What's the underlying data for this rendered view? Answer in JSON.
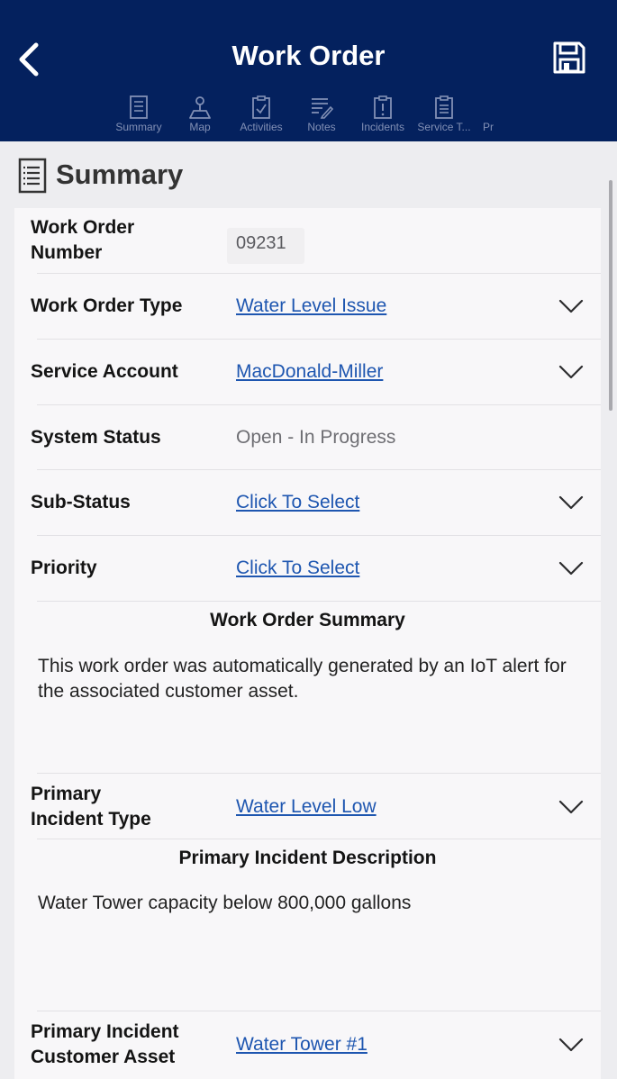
{
  "header": {
    "title": "Work Order",
    "back_icon": "chevron-left-icon",
    "save_icon": "floppy-disk-icon",
    "colors": {
      "background": "#04215e",
      "tab_text": "#8290b5"
    }
  },
  "tabs": [
    {
      "label": "Summary",
      "icon": "list-document-icon"
    },
    {
      "label": "Map",
      "icon": "map-pin-icon"
    },
    {
      "label": "Activities",
      "icon": "clipboard-check-icon"
    },
    {
      "label": "Notes",
      "icon": "notes-pencil-icon"
    },
    {
      "label": "Incidents",
      "icon": "clipboard-alert-icon"
    },
    {
      "label": "Service T...",
      "icon": "clipboard-list-icon"
    },
    {
      "label": "Pr",
      "icon": ""
    }
  ],
  "section": {
    "title": "Summary",
    "icon": "list-document-icon"
  },
  "fields": {
    "work_order_number": {
      "label": "Work Order\nNumber",
      "value": "09231"
    },
    "work_order_type": {
      "label": "Work Order Type",
      "value": "Water Level Issue"
    },
    "service_account": {
      "label": "Service Account",
      "value": "MacDonald-Miller"
    },
    "system_status": {
      "label": "System Status",
      "value": "Open - In Progress"
    },
    "sub_status": {
      "label": "Sub-Status",
      "value": "Click To Select"
    },
    "priority": {
      "label": "Priority",
      "value": "Click To Select"
    },
    "primary_incident_type": {
      "label": "Primary\nIncident Type",
      "value": "Water Level Low"
    },
    "primary_incident_customer_asset": {
      "label": "Primary Incident\nCustomer Asset",
      "value": "Water Tower #1"
    }
  },
  "work_order_summary": {
    "title": "Work Order Summary",
    "text": "This work order was automatically generated by an IoT alert for the associated customer asset."
  },
  "primary_incident_description": {
    "title": "Primary Incident Description",
    "text": "Water Tower capacity below 800,000 gallons"
  },
  "colors": {
    "link": "#1e56b0",
    "static_value": "#6e6e73"
  }
}
